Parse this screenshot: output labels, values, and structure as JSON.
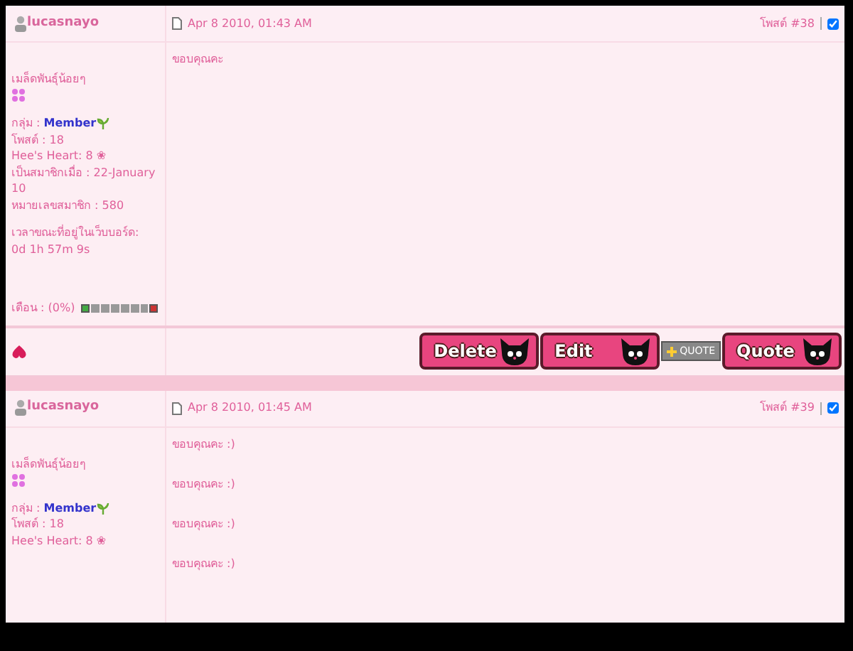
{
  "posts": [
    {
      "author": "lucasnayo",
      "date": "Apr 8 2010, 01:43 AM",
      "post_number": "โพสต์ #38",
      "selected": true,
      "rank": "เมล็ดพันธุ์น้อยๆ",
      "group_label": "กลุ่ม : ",
      "group": "Member",
      "posts_count": "โพสต์ : 18",
      "hearts": "Hee's Heart: 8 ❀",
      "joined": "เป็นสมาชิกเมื่อ : 22-January 10",
      "member_no": "หมายเลขสมาชิก : 580",
      "online_label": "เวลาขณะที่อยู่ในเว็บบอร์ด:",
      "online_time": "0d 1h 57m 9s",
      "warn": "เตือน : (0%)",
      "warn_level": {
        "level": 0
      },
      "body": [
        "ขอบคุณคะ"
      ],
      "buttons": [
        {
          "kind": "big",
          "label": "Delete"
        },
        {
          "kind": "big",
          "label": "Edit"
        },
        {
          "kind": "small",
          "label": "QUOTE"
        },
        {
          "kind": "big",
          "label": "Quote"
        }
      ]
    },
    {
      "author": "lucasnayo",
      "date": "Apr 8 2010, 01:45 AM",
      "post_number": "โพสต์ #39",
      "selected": true,
      "rank": "เมล็ดพันธุ์น้อยๆ",
      "group_label": "กลุ่ม : ",
      "group": "Member",
      "posts_count": "โพสต์ : 18",
      "hearts": "Hee's Heart: 8 ❀",
      "body": [
        "ขอบคุณคะ :)",
        "ขอบคุณคะ :)",
        "ขอบคุณคะ :)",
        "ขอบคุณคะ :)"
      ]
    }
  ]
}
